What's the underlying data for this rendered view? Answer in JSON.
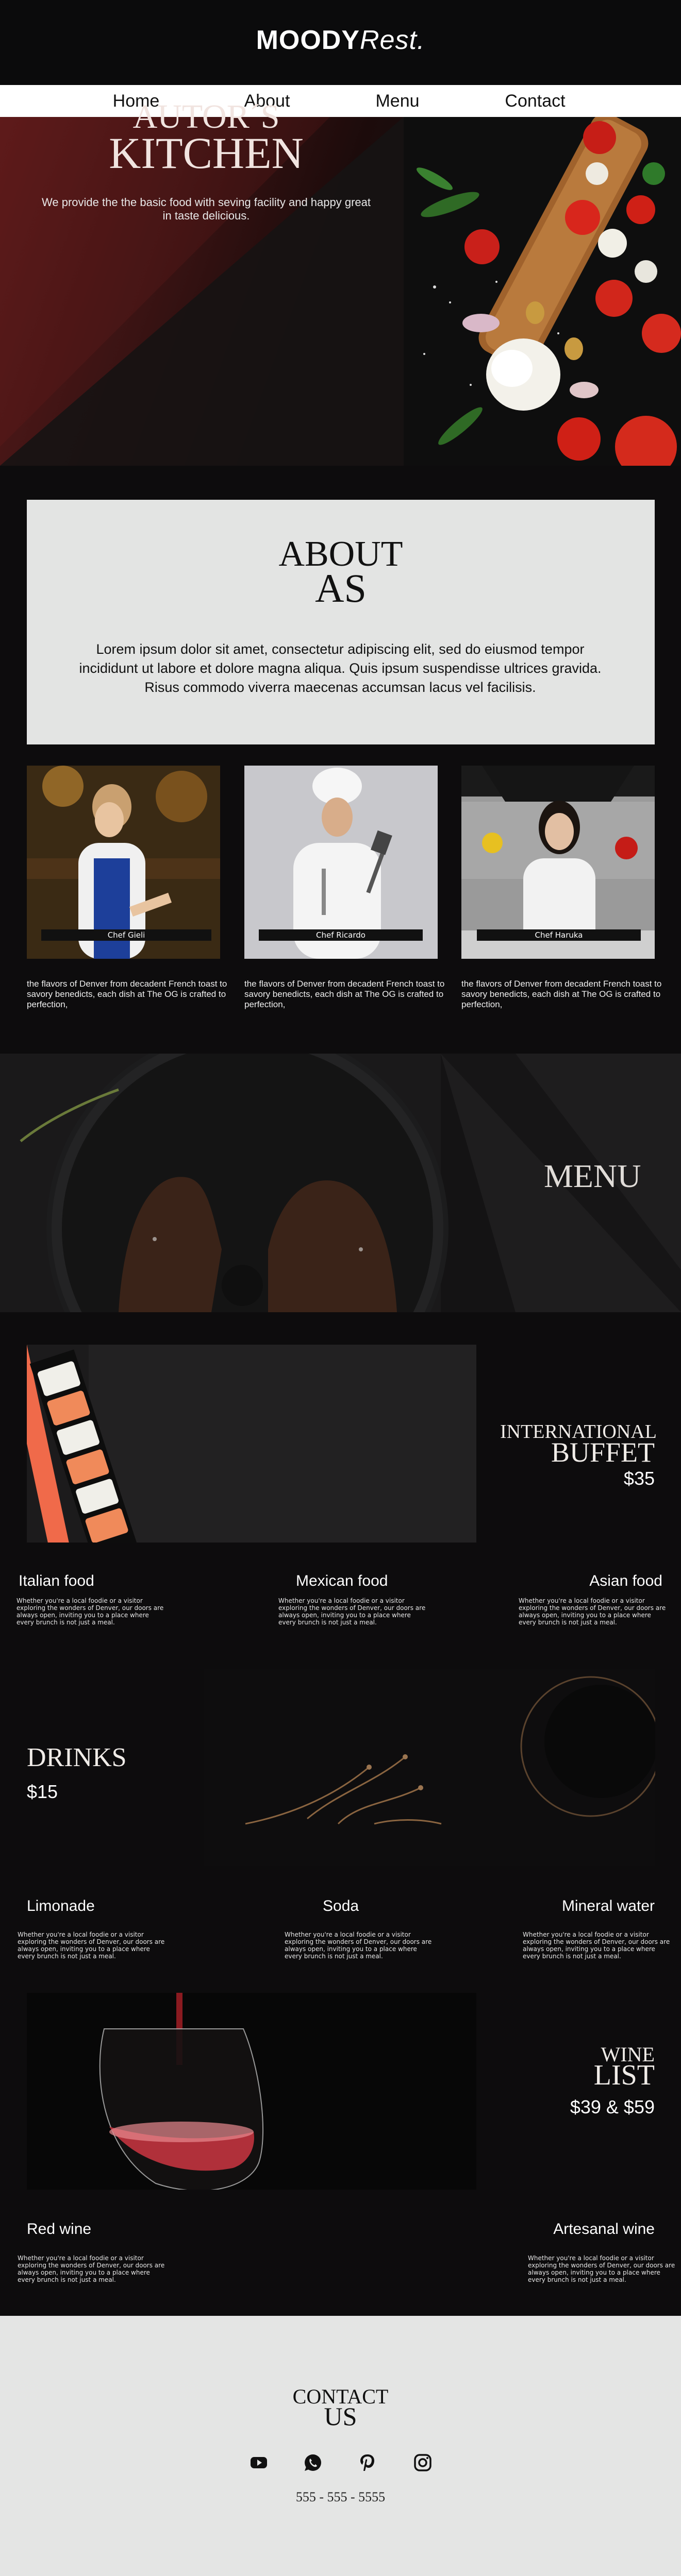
{
  "brand": {
    "bold": "MOODY",
    "italic": "Rest."
  },
  "nav": {
    "items": [
      "Home",
      "About",
      "Menu",
      "Contact"
    ]
  },
  "hero": {
    "title_line1": "AUTOR´S",
    "title_line2": "KITCHEN",
    "text": "We provide the the basic food with seving facility and happy great in taste delicious."
  },
  "about": {
    "title_line1": "ABOUT",
    "title_line2": "AS",
    "text": "Lorem ipsum dolor sit amet, consectetur adipiscing elit, sed do eiusmod tempor incididunt ut labore et dolore magna aliqua. Quis ipsum suspendisse ultrices gravida. Risus commodo viverra maecenas accumsan lacus vel facilisis.",
    "chefs": [
      {
        "name": "Chef Gieli",
        "text": "the flavors of Denver from decadent French toast to savory benedicts, each dish at The OG is crafted to perfection,"
      },
      {
        "name": "Chef Ricardo",
        "text": "the flavors of Denver from decadent French toast to savory benedicts, each dish at The OG is crafted to perfection,"
      },
      {
        "name": "Chef Haruka",
        "text": "the flavors of Denver from decadent French toast to savory benedicts, each dish at The OG is crafted to perfection,"
      }
    ]
  },
  "menu": {
    "title": "MENU"
  },
  "buffet": {
    "title_line1": "INTERNATIONAL",
    "title_line2": "BUFFET",
    "price": "$35",
    "items": [
      {
        "name": "Italian food",
        "text": "Whether you're a local foodie or a visitor exploring the wonders of Denver, our doors are always open, inviting you to a place where every brunch is not just a meal."
      },
      {
        "name": "Mexican food",
        "text": "Whether you're a local foodie or a visitor exploring the wonders of Denver, our doors are always open, inviting you to a place where every brunch is not just a meal."
      },
      {
        "name": "Asian food",
        "text": "Whether you're a local foodie or a visitor exploring the wonders of Denver, our doors are always open, inviting you to a place where every brunch is not just a meal."
      }
    ]
  },
  "drinks": {
    "title": "DRINKS",
    "price": "$15",
    "items": [
      {
        "name": "Limonade",
        "text": "Whether you're a local foodie or a visitor exploring the wonders of Denver, our doors are always open, inviting you to a place where every brunch is not just a meal."
      },
      {
        "name": "Soda",
        "text": "Whether you're a local foodie or a visitor exploring the wonders of Denver, our doors are always open, inviting you to a place where every brunch is not just a meal."
      },
      {
        "name": "Mineral water",
        "text": "Whether you're a local foodie or a visitor exploring the wonders of Denver, our doors are always open, inviting you to a place where every brunch is not just a meal."
      }
    ]
  },
  "wine": {
    "title_line1": "WINE",
    "title_line2": "LIST",
    "price": "$39 & $59",
    "items": [
      {
        "name": "Red wine",
        "text": "Whether you're a local foodie or a visitor exploring the wonders of Denver, our doors are always open, inviting you to a place where every brunch is not just a meal."
      },
      {
        "name": "Artesanal wine",
        "text": "Whether you're a local foodie or a visitor exploring the wonders of Denver, our doors are always open, inviting you to a place where every brunch is not just a meal."
      }
    ]
  },
  "contact": {
    "title_line1": "CONTACT",
    "title_line2": "US",
    "social": [
      "youtube-icon",
      "whatsapp-icon",
      "pinterest-icon",
      "instagram-icon"
    ],
    "phone": "555 - 555 - 5555"
  }
}
